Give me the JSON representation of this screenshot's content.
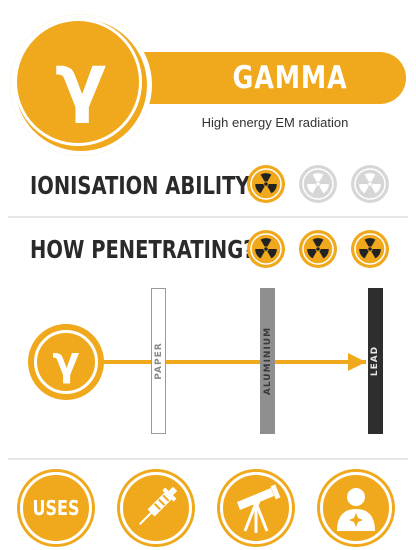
{
  "header": {
    "symbol": "γ",
    "title": "GAMMA",
    "subtitle": "High energy EM radiation"
  },
  "ionisation": {
    "label": "IONISATION ABILITY:",
    "rating": 1,
    "max": 3
  },
  "penetration": {
    "label": "HOW PENETRATING?",
    "rating": 3,
    "max": 3
  },
  "diagram": {
    "symbol": "γ",
    "barriers": [
      {
        "label": "PAPER",
        "style": "outline"
      },
      {
        "label": "ALUMINIUM",
        "style": "grey"
      },
      {
        "label": "LEAD",
        "style": "dark"
      }
    ]
  },
  "footer": {
    "uses_label": "USES",
    "buttons": [
      "uses-button",
      "medical-syringe-button",
      "telescope-button",
      "person-hazard-button"
    ]
  },
  "colors": {
    "accent": "#f0a81c",
    "dark_text": "#2a2a2a",
    "grey_bar": "#8f8f8f",
    "dark_bar": "#2e2e2e",
    "inactive_icon": "#d6d6d6"
  }
}
